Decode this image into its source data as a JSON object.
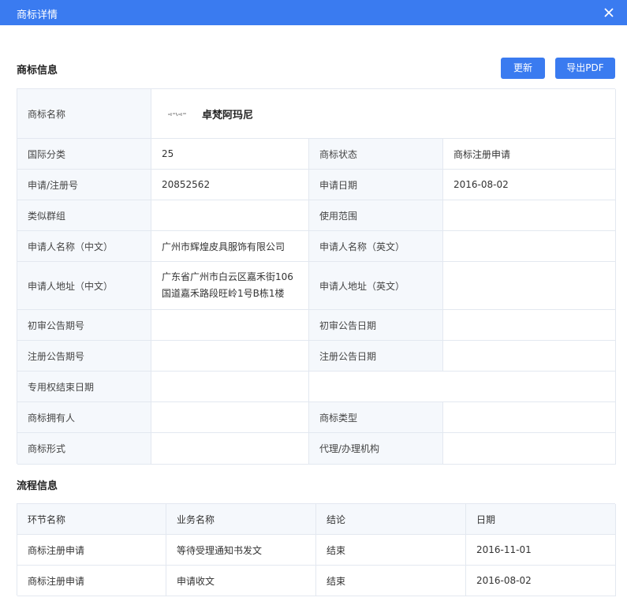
{
  "dialog": {
    "title": "商标详情"
  },
  "sections": {
    "info_title": "商标信息",
    "flow_title": "流程信息"
  },
  "buttons": {
    "refresh": "更新",
    "export_pdf": "导出PDF"
  },
  "colors": {
    "accent": "#3a7bf0",
    "label_bg": "#f5f8fc",
    "border": "#e3e8f0"
  },
  "info": {
    "name_label": "商标名称",
    "name_value": "卓梵阿玛尼",
    "intl_class_label": "国际分类",
    "intl_class_value": "25",
    "status_label": "商标状态",
    "status_value": "商标注册申请",
    "reg_no_label": "申请/注册号",
    "reg_no_value": "20852562",
    "apply_date_label": "申请日期",
    "apply_date_value": "2016-08-02",
    "similar_group_label": "类似群组",
    "similar_group_value": "",
    "scope_label": "使用范围",
    "scope_value": "",
    "applicant_cn_label": "申请人名称（中文）",
    "applicant_cn_value": "广州市辉煌皮具服饰有限公司",
    "applicant_en_label": "申请人名称（英文）",
    "applicant_en_value": "",
    "address_cn_label": "申请人地址（中文）",
    "address_cn_line1": "广东省广州市白云区嘉禾街106",
    "address_cn_line2": "国道嘉禾路段旺岭1号B栋1楼",
    "address_en_label": "申请人地址（英文）",
    "address_en_value": "",
    "prelim_no_label": "初审公告期号",
    "prelim_no_value": "",
    "prelim_date_label": "初审公告日期",
    "prelim_date_value": "",
    "reg_notice_no_label": "注册公告期号",
    "reg_notice_no_value": "",
    "reg_notice_date_label": "注册公告日期",
    "reg_notice_date_value": "",
    "exclusive_end_label": "专用权结束日期",
    "exclusive_end_value": "",
    "owner_label": "商标拥有人",
    "owner_value": "",
    "type_label": "商标类型",
    "type_value": "",
    "form_label": "商标形式",
    "form_value": "",
    "agent_label": "代理/办理机构",
    "agent_value": ""
  },
  "flow": {
    "headers": [
      "环节名称",
      "业务名称",
      "结论",
      "日期"
    ],
    "rows": [
      [
        "商标注册申请",
        "等待受理通知书发文",
        "结束",
        "2016-11-01"
      ],
      [
        "商标注册申请",
        "申请收文",
        "结束",
        "2016-08-02"
      ]
    ]
  }
}
